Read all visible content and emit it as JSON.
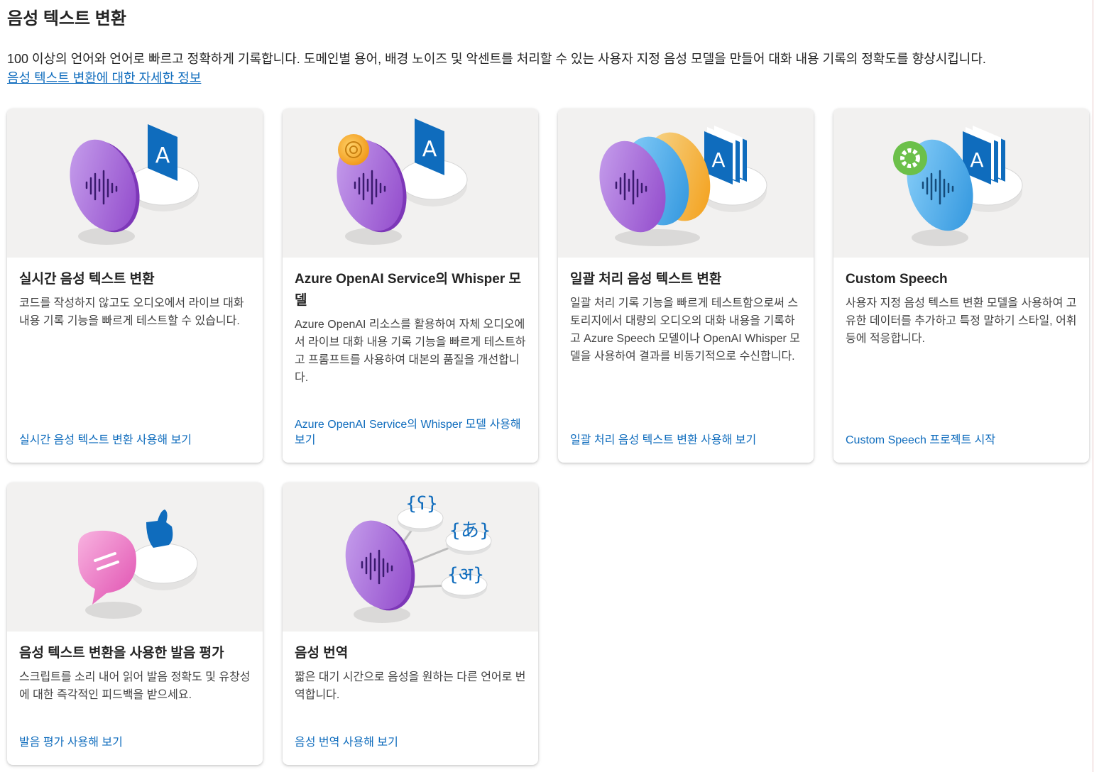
{
  "page": {
    "title": "음성 텍스트 변환",
    "description": "100 이상의 언어와 언어로 빠르고 정확하게 기록합니다. 도메인별 용어, 배경 노이즈 및 악센트를 처리할 수 있는 사용자 지정 음성 모델을 만들어 대화 내용 기록의 정확도를 향상시킵니다.",
    "learn_more": "음성 텍스트 변환에 대한 자세한 정보"
  },
  "cards": [
    {
      "title": "실시간 음성 텍스트 변환",
      "text": "코드를 작성하지 않고도 오디오에서 라이브 대화 내용 기록 기능을 빠르게 테스트할 수 있습니다.",
      "link": "실시간 음성 텍스트 변환 사용해 보기"
    },
    {
      "title": "Azure OpenAI Service의 Whisper 모델",
      "text": "Azure OpenAI 리소스를 활용하여 자체 오디오에서 라이브 대화 내용 기록 기능을 빠르게 테스트하고 프롬프트를 사용하여 대본의 품질을 개선합니다.",
      "link": "Azure OpenAI Service의 Whisper 모델 사용해 보기"
    },
    {
      "title": "일괄 처리 음성 텍스트 변환",
      "text": "일괄 처리 기록 기능을 빠르게 테스트함으로써 스토리지에서 대량의 오디오의 대화 내용을 기록하고 Azure Speech 모델이나 OpenAI Whisper 모델을 사용하여 결과를 비동기적으로 수신합니다.",
      "link": "일괄 처리 음성 텍스트 변환 사용해 보기"
    },
    {
      "title": "Custom Speech",
      "text": "사용자 지정 음성 텍스트 변환 모델을 사용하여 고유한 데이터를 추가하고 특정 말하기 스타일, 어휘 등에 적응합니다.",
      "link": "Custom Speech 프로젝트 시작"
    },
    {
      "title": "음성 텍스트 변환을 사용한 발음 평가",
      "text": "스크립트를 소리 내어 읽어 발음 정확도 및 유창성에 대한 즉각적인 피드백을 받으세요.",
      "link": "발음 평가 사용해 보기"
    },
    {
      "title": "음성 번역",
      "text": "짧은 대기 시간으로 음성을 원하는 다른 언어로 번역합니다.",
      "link": "음성 번역 사용해 보기"
    }
  ],
  "illustrations": {
    "letter": "A",
    "translation_glyphs": [
      "{ʕ}",
      "{あ}",
      "{अ}"
    ]
  },
  "colors": {
    "link": "#0f6cbd",
    "purple_disc": "#9b59d6",
    "blue_disc": "#3aa8ec",
    "orange_disc": "#f5a623",
    "pink_bubble": "#ee6fc0",
    "tile_blue": "#0f6cbd",
    "gear_green": "#4caf50"
  }
}
